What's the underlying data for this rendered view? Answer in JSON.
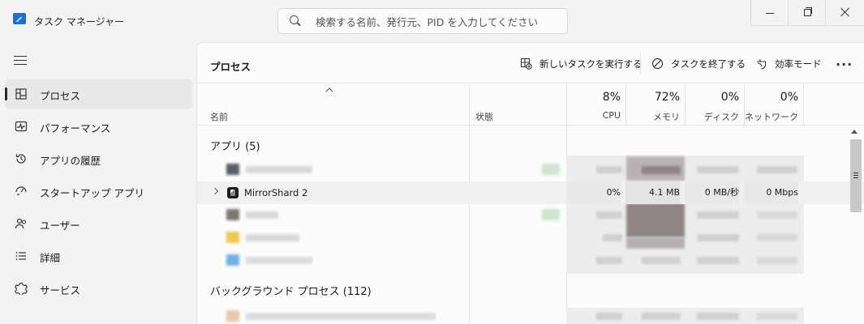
{
  "titlebar": {
    "app_title": "タスク マネージャー",
    "search_placeholder": "検索する名前、発行元、PID を入力してください"
  },
  "sidebar": {
    "items": [
      {
        "label": "プロセス",
        "icon": "processes-icon",
        "active": true
      },
      {
        "label": "パフォーマンス",
        "icon": "performance-icon"
      },
      {
        "label": "アプリの履歴",
        "icon": "history-icon"
      },
      {
        "label": "スタートアップ アプリ",
        "icon": "startup-icon"
      },
      {
        "label": "ユーザー",
        "icon": "users-icon"
      },
      {
        "label": "詳細",
        "icon": "details-icon"
      },
      {
        "label": "サービス",
        "icon": "services-icon"
      }
    ]
  },
  "toolbar": {
    "title": "プロセス",
    "new_task": "新しいタスクを実行する",
    "end_task": "タスクを終了する",
    "efficiency": "効率モード"
  },
  "columns": {
    "name": "名前",
    "status": "状態",
    "cpu": {
      "label": "CPU",
      "value": "8%"
    },
    "memory": {
      "label": "メモリ",
      "value": "72%"
    },
    "disk": {
      "label": "ディスク",
      "value": "0%"
    },
    "network": {
      "label": "ネットワーク",
      "value": "0%"
    }
  },
  "groups": {
    "apps": "アプリ (5)",
    "background": "バックグラウンド プロセス (112)"
  },
  "selected_row": {
    "name": "MirrorShard 2",
    "cpu": "0%",
    "memory": "4.1 MB",
    "disk": "0 MB/秒",
    "network": "0 Mbps"
  },
  "colors": {
    "accent": "#2b2b2b",
    "heat_light": "#ededed",
    "heat_dark": "#6f6464"
  }
}
